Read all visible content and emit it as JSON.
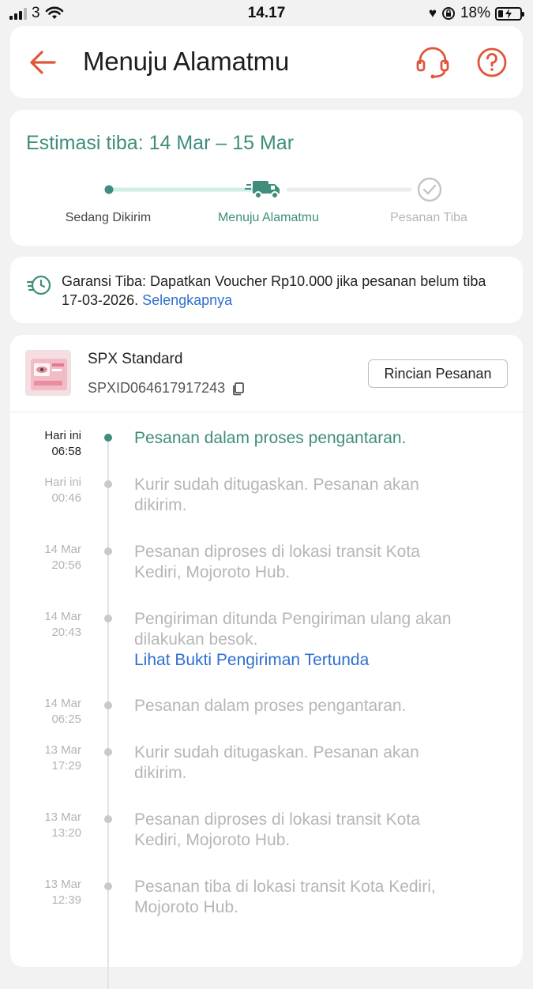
{
  "status_bar": {
    "carrier": "3",
    "time": "14.17",
    "battery": "18%"
  },
  "header": {
    "title": "Menuju Alamatmu",
    "icons": [
      "back-arrow-icon",
      "headset-icon",
      "help-icon"
    ],
    "accent": "#e0553a"
  },
  "estimate": {
    "title": "Estimasi tiba: 14 Mar – 15 Mar",
    "steps": [
      {
        "label": "Sedang Dikirim",
        "state": "done"
      },
      {
        "label": "Menuju Alamatmu",
        "state": "current"
      },
      {
        "label": "Pesanan Tiba",
        "state": "pending"
      }
    ],
    "color": "#3f8d7c"
  },
  "guarantee": {
    "text": "Garansi Tiba: Dapatkan Voucher Rp10.000 jika pesanan belum tiba 17-03-2026.",
    "link": "Selengkapnya"
  },
  "shipment": {
    "courier": "SPX Standard",
    "tracking_id": "SPXID064617917243",
    "detail_button": "Rincian Pesanan"
  },
  "events": [
    {
      "date": "Hari ini",
      "time": "06:58",
      "text": "Pesanan dalam proses pengantaran.",
      "active": true
    },
    {
      "date": "Hari ini",
      "time": "00:46",
      "text": "Kurir sudah ditugaskan. Pesanan akan dikirim."
    },
    {
      "date": "14 Mar",
      "time": "20:56",
      "text": "Pesanan diproses di lokasi transit Kota Kediri, Mojoroto Hub."
    },
    {
      "date": "14 Mar",
      "time": "20:43",
      "text": "Pengiriman ditunda  Pengiriman ulang akan dilakukan besok.",
      "link": "Lihat Bukti Pengiriman Tertunda"
    },
    {
      "date": "14 Mar",
      "time": "06:25",
      "text": "Pesanan dalam proses pengantaran."
    },
    {
      "date": "13 Mar",
      "time": "17:29",
      "text": "Kurir sudah ditugaskan. Pesanan akan dikirim."
    },
    {
      "date": "13 Mar",
      "time": "13:20",
      "text": "Pesanan diproses di lokasi transit Kota Kediri, Mojoroto Hub."
    },
    {
      "date": "13 Mar",
      "time": "12:39",
      "text": "Pesanan tiba di lokasi transit Kota Kediri, Mojoroto Hub."
    }
  ]
}
